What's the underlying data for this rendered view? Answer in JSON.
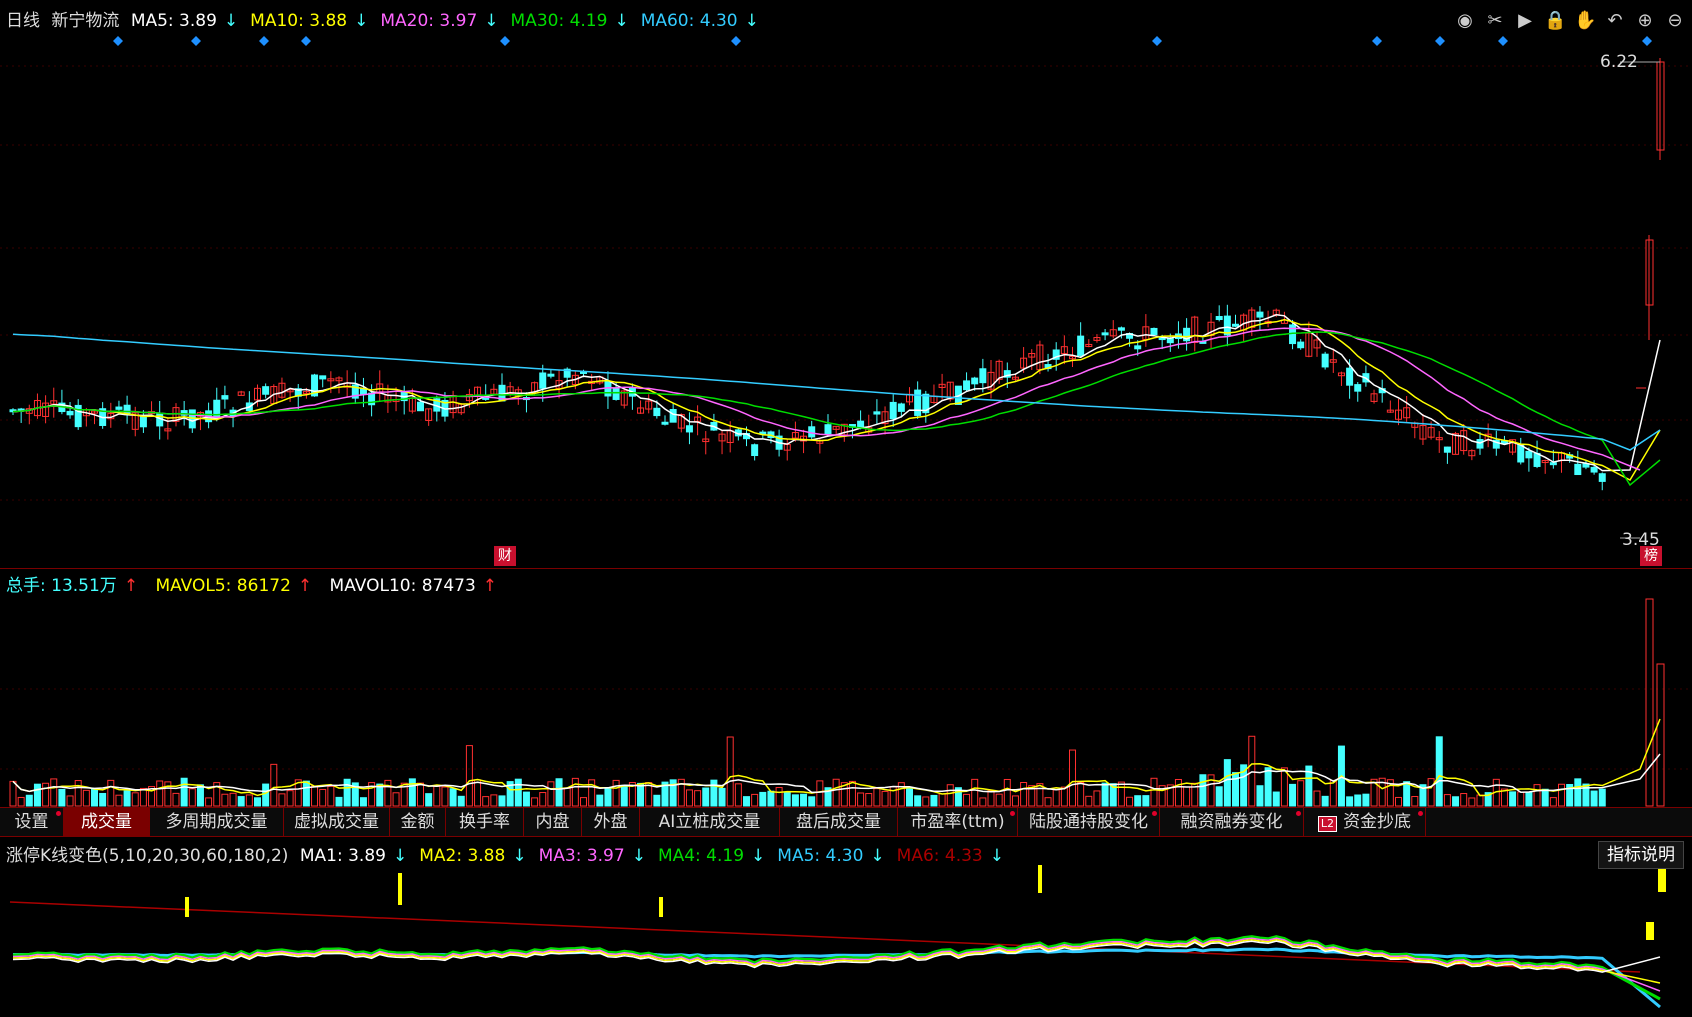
{
  "main": {
    "period": "日线",
    "stock_name": "新宁物流",
    "ma": [
      {
        "label": "MA5: 3.89",
        "arrow": "↓",
        "color": "#ffffff"
      },
      {
        "label": "MA10: 3.88",
        "arrow": "↓",
        "color": "#ffff00"
      },
      {
        "label": "MA20: 3.97",
        "arrow": "↓",
        "color": "#ff66ff"
      },
      {
        "label": "MA30: 4.19",
        "arrow": "↓",
        "color": "#00dd00"
      },
      {
        "label": "MA60: 4.30",
        "arrow": "↓",
        "color": "#33ccff"
      }
    ],
    "high_label": "6.22",
    "low_label": "3.45",
    "finance_mark": "财",
    "rank_mark": "榜"
  },
  "toolbar": {
    "icons": [
      "eye-icon",
      "scissors-icon",
      "play-icon",
      "lock-icon",
      "hand-icon",
      "undo-icon",
      "zoom-in-icon",
      "zoom-out-icon"
    ]
  },
  "volume": {
    "total_label": "总手: 13.51万",
    "total_arrow": "↑",
    "mavol5_label": "MAVOL5: 86172",
    "mavol5_arrow": "↑",
    "mavol10_label": "MAVOL10: 87473",
    "mavol10_arrow": "↑"
  },
  "tabs": [
    {
      "label": "设置",
      "dot": true
    },
    {
      "label": "成交量",
      "active": true
    },
    {
      "label": "多周期成交量"
    },
    {
      "label": "虚拟成交量"
    },
    {
      "label": "金额"
    },
    {
      "label": "换手率"
    },
    {
      "label": "内盘"
    },
    {
      "label": "外盘"
    },
    {
      "label": "AI立桩成交量"
    },
    {
      "label": "盘后成交量"
    },
    {
      "label": "市盈率(ttm)",
      "dot": true
    },
    {
      "label": "陆股通持股变化",
      "dot": true
    },
    {
      "label": "融资融券变化",
      "dot": true
    },
    {
      "label": "资金抄底",
      "dot": true,
      "badge": "L2"
    }
  ],
  "indicator": {
    "name": "涨停K线变色(5,10,20,30,60,180,2)",
    "ma": [
      {
        "label": "MA1: 3.89",
        "arrow": "↓",
        "color": "#ffffff"
      },
      {
        "label": "MA2: 3.88",
        "arrow": "↓",
        "color": "#ffff00"
      },
      {
        "label": "MA3: 3.97",
        "arrow": "↓",
        "color": "#ff66ff"
      },
      {
        "label": "MA4: 4.19",
        "arrow": "↓",
        "color": "#00dd00"
      },
      {
        "label": "MA5: 4.30",
        "arrow": "↓",
        "color": "#33ccff"
      },
      {
        "label": "MA6: 4.33",
        "arrow": "↓",
        "color": "#aa0000"
      }
    ],
    "explain_label": "指标说明"
  },
  "colors": {
    "up": "#ff3030",
    "down": "#44ffff",
    "border": "#7a0000"
  }
}
